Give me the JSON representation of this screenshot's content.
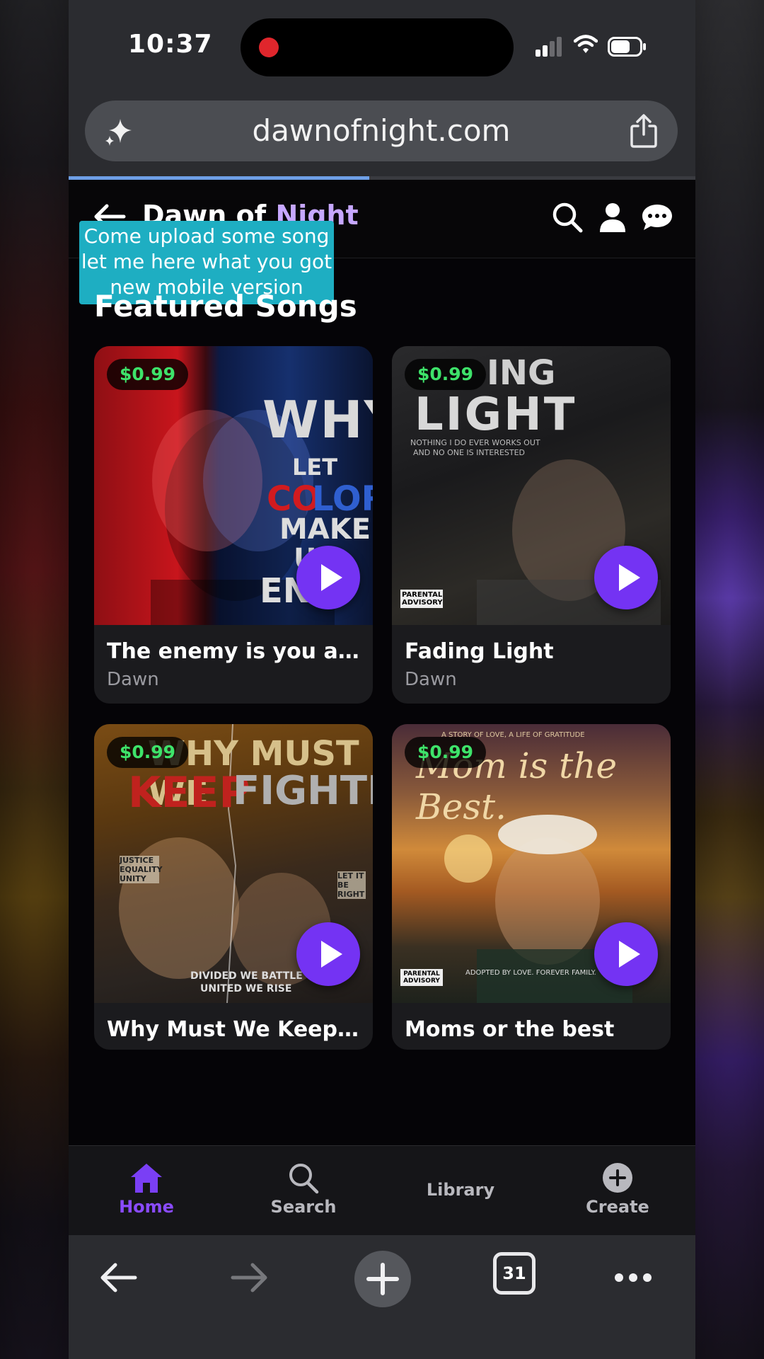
{
  "status_bar": {
    "time": "10:37"
  },
  "browser": {
    "url": "dawnofnight.com",
    "load_progress": 0.48,
    "tab_count": "31"
  },
  "site": {
    "title_part1": "Dawn of ",
    "title_part2": "Night"
  },
  "caption": {
    "line1": "Come upload some song",
    "line2": "let me here what you got",
    "line3": "new mobile version"
  },
  "featured": {
    "heading": "Featured Songs",
    "songs": [
      {
        "price": "$0.99",
        "title": "The enemy is you an...",
        "artist": "Dawn"
      },
      {
        "price": "$0.99",
        "title": "Fading Light",
        "artist": "Dawn"
      },
      {
        "price": "$0.99",
        "title": "Why Must We Keep ...",
        "artist": ""
      },
      {
        "price": "$0.99",
        "title": "Moms or the best",
        "artist": ""
      }
    ]
  },
  "art_text": {
    "song1": [
      "WHY",
      "LET",
      "CO",
      "LOR",
      "MAKE",
      "US",
      "ENE"
    ],
    "song2": [
      "ING",
      "LIGHT",
      "NOTHING I DO EVER WORKS OUT",
      "AND NO ONE IS INTERESTED",
      "PARENTAL ADVISORY"
    ],
    "song3": [
      "WHY MUST WE",
      "KEEP",
      "FIGHTING",
      "DIVIDED WE BATTLE",
      "UNITED WE RISE",
      "JUSTICE EQUALITY UNITY",
      "LET IT BE RIGHT"
    ],
    "song4": [
      "A STORY OF LOVE, A LIFE OF GRATITUDE",
      "Mom is the Best.",
      "ADOPTED BY LOVE. FOREVER FAMILY.",
      "PARENTAL ADVISORY"
    ]
  },
  "app_nav": [
    {
      "label": "Home",
      "icon": "home-icon",
      "active": true
    },
    {
      "label": "Search",
      "icon": "search-icon",
      "active": false
    },
    {
      "label": "Library",
      "icon": "",
      "active": false
    },
    {
      "label": "Create",
      "icon": "plus-circle-icon",
      "active": false
    }
  ],
  "colors": {
    "accent": "#7433f3",
    "price_green": "#3ee36a",
    "caption_bg": "#1eaec2",
    "progress": "#6e9fe6"
  }
}
